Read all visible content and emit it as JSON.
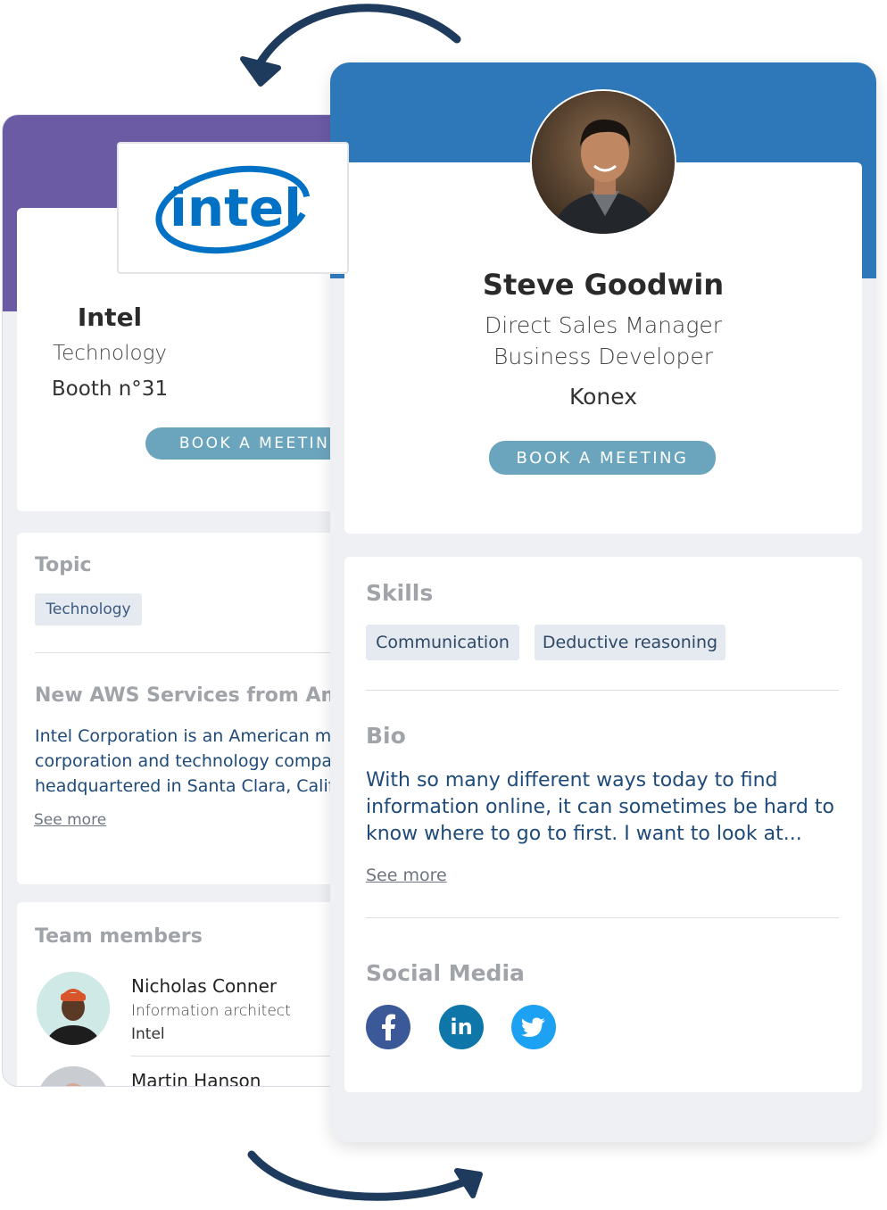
{
  "company_card": {
    "logo_text": "intel",
    "name": "Intel",
    "category": "Technology",
    "booth": "Booth n°31",
    "book_button": "BOOK A MEETING",
    "topic_title": "Topic",
    "topic_tag": "Technology",
    "session_title": "New AWS Services from Ama",
    "description": "Intel Corporation is an American m\ncorporation and technology compa\nheadquartered in Santa Clara, Calif",
    "see_more": "See more",
    "team_title": "Team members",
    "members": [
      {
        "name": "Nicholas Conner",
        "role": "Information architect",
        "company": "Intel"
      },
      {
        "name": "Martin Hanson"
      }
    ],
    "colors": {
      "band": "#6b5aa4",
      "intel_blue": "#0071c5"
    }
  },
  "person_card": {
    "name": "Steve Goodwin",
    "title_line1": "Direct Sales Manager",
    "title_line2": "Business Developer",
    "company": "Konex",
    "book_button": "BOOK A MEETING",
    "skills_title": "Skills",
    "skills": [
      "Communication",
      "Deductive reasoning"
    ],
    "bio_title": "Bio",
    "bio": "With so many different ways today to find\ninformation online, it can sometimes be hard to\nknow where to go to first. I want to look at...",
    "see_more": "See more",
    "social_title": "Social Media",
    "social": [
      {
        "icon": "facebook-icon",
        "glyph": "f",
        "color": "#3b5998"
      },
      {
        "icon": "linkedin-icon",
        "glyph": "in",
        "color": "#0e76a8"
      },
      {
        "icon": "twitter-icon",
        "glyph": "t",
        "color": "#1da1f2"
      }
    ],
    "colors": {
      "band": "#2e78ba",
      "button": "#6ba5bd"
    }
  }
}
